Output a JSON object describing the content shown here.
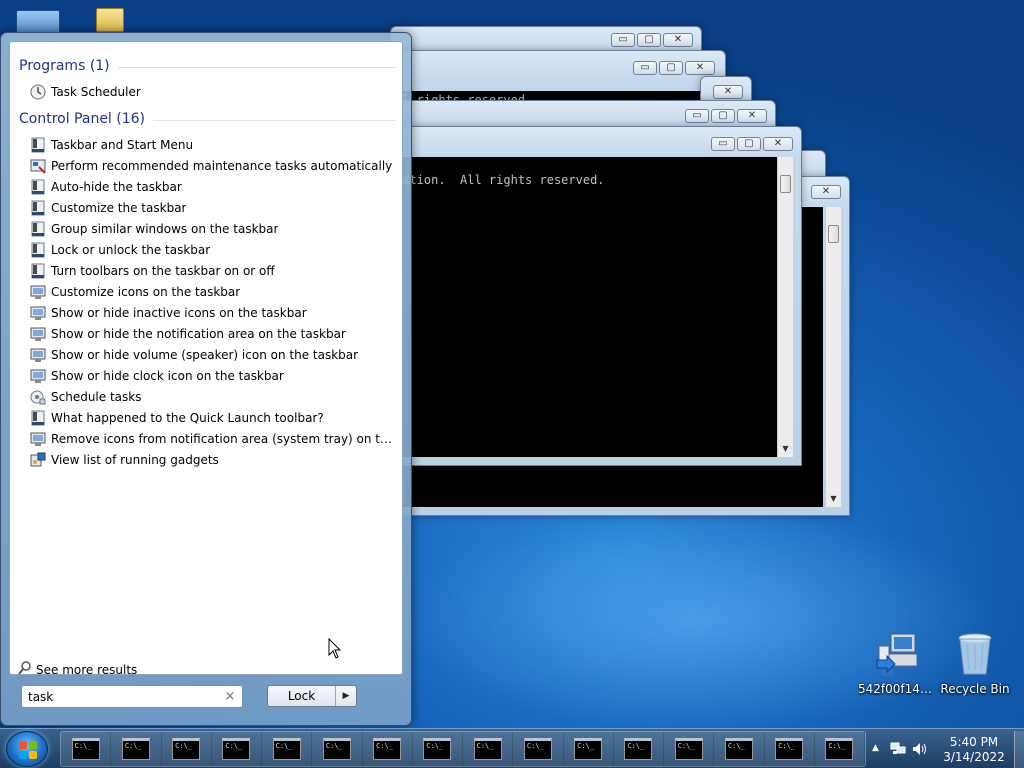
{
  "desktop": {
    "icons": [
      {
        "label": "542f00f144d...",
        "icon": "network-computer-icon"
      },
      {
        "label": "Recycle Bin",
        "icon": "recycle-bin-icon"
      }
    ]
  },
  "cmd_windows": {
    "text_fragments": [
      "ll rights reserved.",
      "]",
      "ration.  All rights reserved."
    ],
    "button_glyphs": {
      "minimize": "▭",
      "maximize": "▢",
      "close": "✕"
    }
  },
  "start_menu": {
    "programs": {
      "header": "Programs (1)",
      "items": [
        {
          "label": "Task Scheduler",
          "icon": "clock-icon"
        }
      ]
    },
    "control_panel": {
      "header": "Control Panel (16)",
      "items": [
        {
          "label": "Taskbar and Start Menu",
          "icon": "taskbar-icon"
        },
        {
          "label": "Perform recommended maintenance tasks automatically",
          "icon": "action-center-icon"
        },
        {
          "label": "Auto-hide the taskbar",
          "icon": "taskbar-icon"
        },
        {
          "label": "Customize the taskbar",
          "icon": "taskbar-icon"
        },
        {
          "label": "Group similar windows on the taskbar",
          "icon": "taskbar-icon"
        },
        {
          "label": "Lock or unlock the taskbar",
          "icon": "taskbar-icon"
        },
        {
          "label": "Turn toolbars on the taskbar on or off",
          "icon": "taskbar-icon"
        },
        {
          "label": "Customize icons on the taskbar",
          "icon": "notification-icon"
        },
        {
          "label": "Show or hide inactive icons on the taskbar",
          "icon": "notification-icon"
        },
        {
          "label": "Show or hide the notification area on the taskbar",
          "icon": "notification-icon"
        },
        {
          "label": "Show or hide volume (speaker) icon on the taskbar",
          "icon": "notification-icon"
        },
        {
          "label": "Show or hide clock icon on the taskbar",
          "icon": "notification-icon"
        },
        {
          "label": "Schedule tasks",
          "icon": "admin-tools-icon"
        },
        {
          "label": "What happened to the Quick Launch toolbar?",
          "icon": "taskbar-icon"
        },
        {
          "label": "Remove icons from notification area (system tray) on the deskt...",
          "icon": "notification-icon"
        },
        {
          "label": "View list of running gadgets",
          "icon": "gadgets-icon"
        }
      ]
    },
    "see_more": "See more results",
    "search": {
      "value": "task",
      "clear_glyph": "×"
    },
    "lock_button": {
      "label": "Lock",
      "arrow": "▶"
    }
  },
  "taskbar": {
    "buttons": [
      "cmd-window-1",
      "cmd-window-2",
      "cmd-window-3",
      "cmd-window-4",
      "cmd-window-5",
      "cmd-window-6",
      "cmd-window-7",
      "cmd-window-8",
      "cmd-window-9",
      "cmd-window-10",
      "cmd-window-11",
      "cmd-window-12",
      "cmd-window-13",
      "cmd-window-14",
      "cmd-window-15",
      "cmd-window-16"
    ],
    "cmd_icon_text": "C:\\_",
    "tray": {
      "show_hidden_glyph": "▲",
      "time": "5:40 PM",
      "date": "3/14/2022"
    }
  },
  "colors": {
    "group_header": "#1e3287",
    "desktop_bg": "#1766bd"
  }
}
